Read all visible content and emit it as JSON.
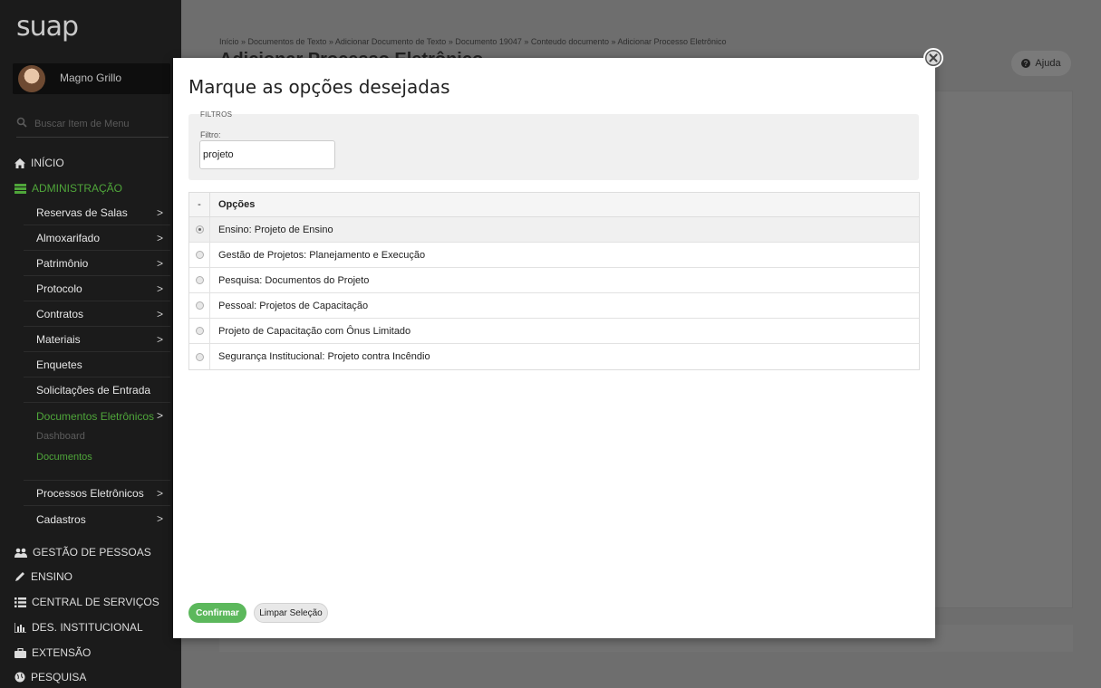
{
  "app": {
    "logo": "suap"
  },
  "user": {
    "name": "Magno Grillo"
  },
  "search": {
    "placeholder": "Buscar Item de Menu"
  },
  "menu": {
    "inicio": "INÍCIO",
    "administracao": "ADMINISTRAÇÃO",
    "admin_items": [
      {
        "label": "Reservas de Salas",
        "chevron": ">"
      },
      {
        "label": "Almoxarifado",
        "chevron": ">"
      },
      {
        "label": "Patrimônio",
        "chevron": ">"
      },
      {
        "label": "Protocolo",
        "chevron": ">"
      },
      {
        "label": "Contratos",
        "chevron": ">"
      },
      {
        "label": "Materiais",
        "chevron": ">"
      },
      {
        "label": "Enquetes"
      },
      {
        "label": "Solicitações de Entrada"
      },
      {
        "label": "Documentos Eletrônicos",
        "chevron": ">"
      }
    ],
    "doc_sub": [
      "Dashboard",
      "Documentos"
    ],
    "admin_items_after": [
      {
        "label": "Processos Eletrônicos",
        "chevron": ">"
      },
      {
        "label": "Cadastros",
        "chevron": ">"
      }
    ],
    "sections": [
      "GESTÃO DE PESSOAS",
      "ENSINO",
      "CENTRAL DE SERVIÇOS",
      "DES. INSTITUCIONAL",
      "EXTENSÃO",
      "PESQUISA"
    ]
  },
  "background": {
    "breadcrumb": "Início » Documentos de Texto » Adicionar Documento de Texto » Documento 19047 » Conteudo documento » Adicionar Processo Eletrônico",
    "title": "Adicionar Processo Eletrônico",
    "help": "Ajuda"
  },
  "modal": {
    "title": "Marque as opções desejadas",
    "filters_legend": "FILTROS",
    "filter_label": "Filtro:",
    "filter_value": "projeto",
    "table_header_select": "-",
    "table_header_options": "Opções",
    "options": [
      {
        "label": "Ensino: Projeto de Ensino",
        "selected": true
      },
      {
        "label": "Gestão de Projetos: Planejamento e Execução",
        "selected": false
      },
      {
        "label": "Pesquisa: Documentos do Projeto",
        "selected": false
      },
      {
        "label": "Pessoal: Projetos de Capacitação",
        "selected": false
      },
      {
        "label": "Projeto de Capacitação com Ônus Limitado",
        "selected": false
      },
      {
        "label": "Segurança Institucional: Projeto contra Incêndio",
        "selected": false
      }
    ],
    "confirm": "Confirmar",
    "clear": "Limpar Seleção"
  },
  "colors": {
    "accent_green": "#4fa63a",
    "confirm_button": "#5cb85c",
    "sidebar_bg": "#1b1b1b"
  }
}
